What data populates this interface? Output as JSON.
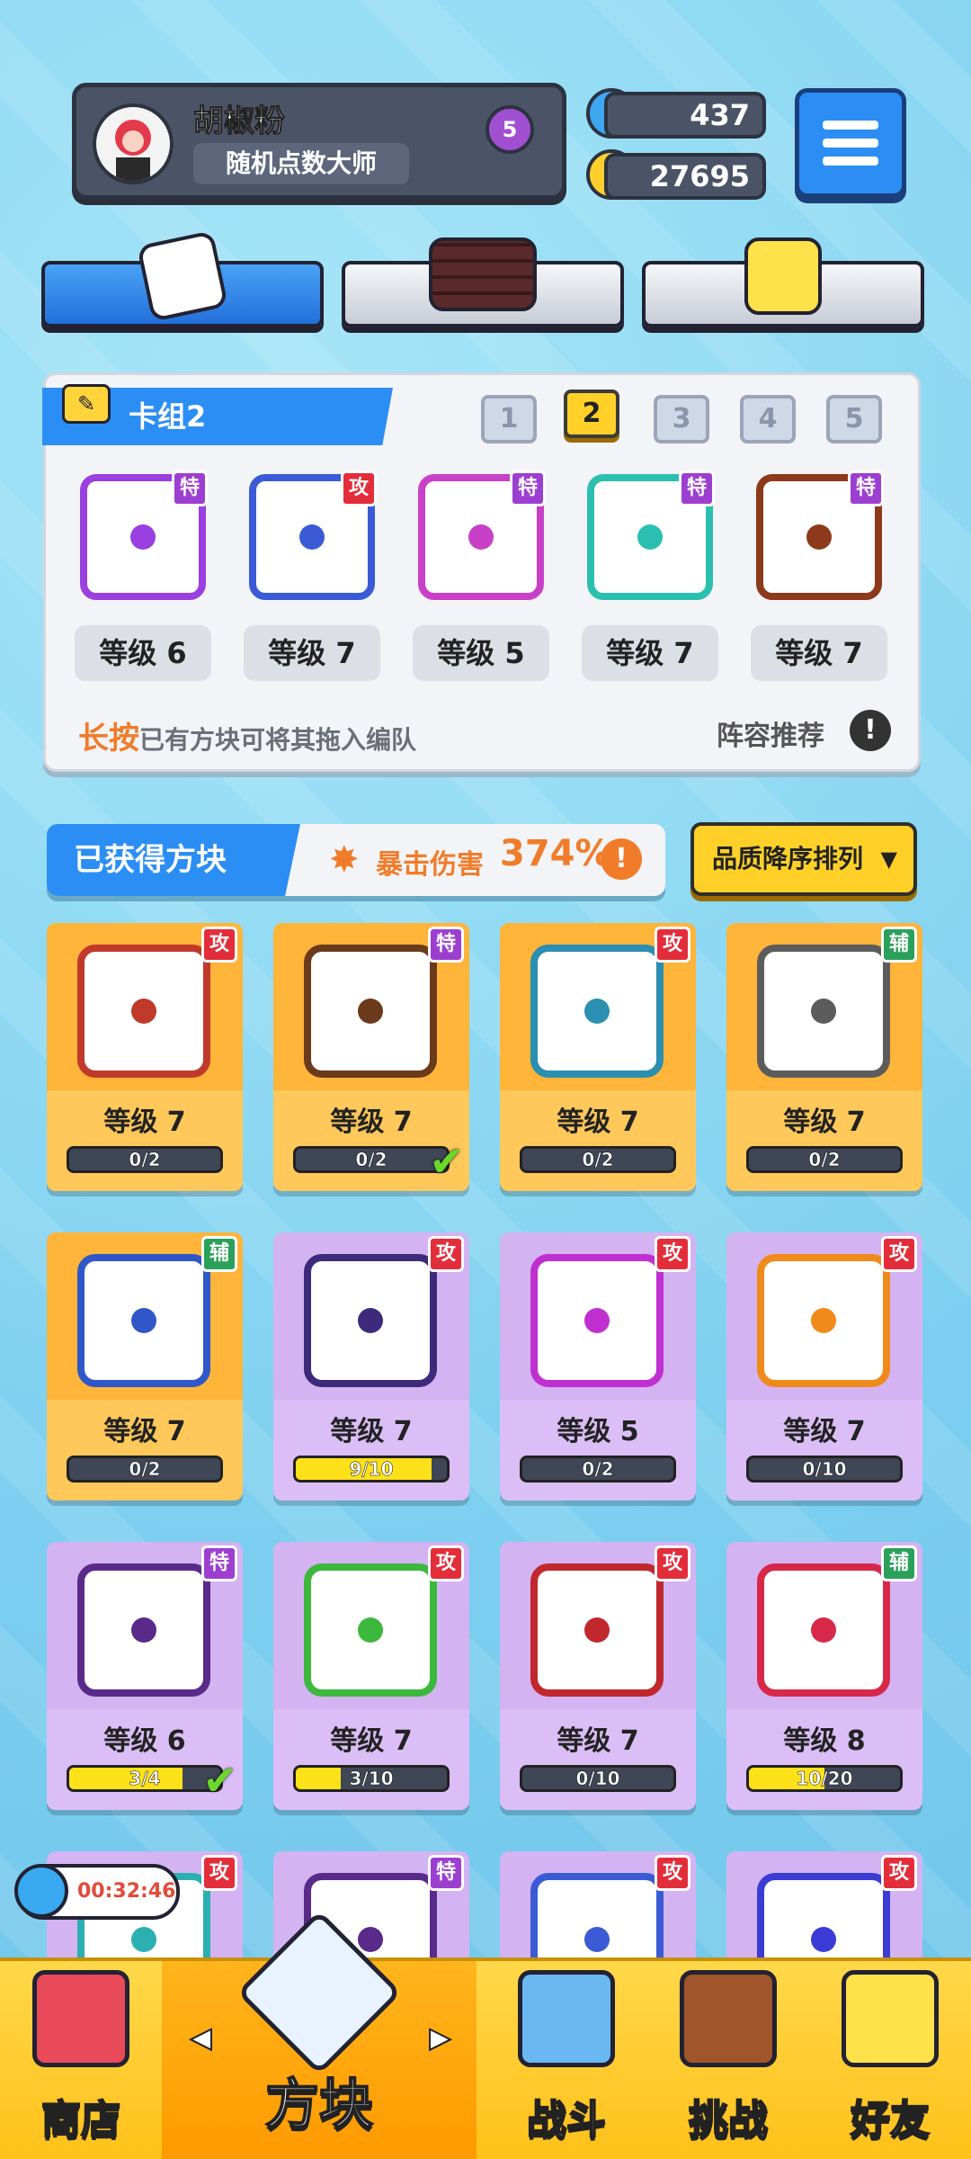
{
  "player": {
    "name": "胡椒粉",
    "title": "随机点数大师",
    "rank": "5"
  },
  "currency": {
    "gems": "437",
    "coins": "27695"
  },
  "deck": {
    "label": "卡组2",
    "numbers": [
      "1",
      "2",
      "3",
      "4",
      "5"
    ],
    "selected": "2",
    "dice": [
      {
        "tag": "特",
        "level": "等级 6",
        "color": "#9a3fe0"
      },
      {
        "tag": "攻",
        "level": "等级 7",
        "color": "#3b5bd6"
      },
      {
        "tag": "特",
        "level": "等级 5",
        "color": "#c840c8"
      },
      {
        "tag": "特",
        "level": "等级 7",
        "color": "#2bbfb0"
      },
      {
        "tag": "特",
        "level": "等级 7",
        "color": "#8c3a1a"
      }
    ],
    "hint_bold": "长按",
    "hint_rest": "已有方块可将其拖入编队",
    "lineup": "阵容推荐"
  },
  "owned": {
    "label": "已获得方块",
    "crit_label": "暴击伤害",
    "crit_value": "374%",
    "sort_label": "品质降序排列"
  },
  "cards": [
    {
      "tag": "攻",
      "level": "等级 7",
      "progress": "0/2",
      "fill": 0,
      "bg": "gold",
      "color": "#c0392b"
    },
    {
      "tag": "特",
      "level": "等级 7",
      "progress": "0/2",
      "fill": 0,
      "bg": "gold",
      "color": "#6b3a1a",
      "check": true
    },
    {
      "tag": "攻",
      "level": "等级 7",
      "progress": "0/2",
      "fill": 0,
      "bg": "gold",
      "color": "#2a8fb0"
    },
    {
      "tag": "辅",
      "level": "等级 7",
      "progress": "0/2",
      "fill": 0,
      "bg": "gold",
      "color": "#5c5c5c"
    },
    {
      "tag": "辅",
      "level": "等级 7",
      "progress": "0/2",
      "fill": 0,
      "bg": "gold",
      "color": "#2f57c8"
    },
    {
      "tag": "攻",
      "level": "等级 7",
      "progress": "9/10",
      "fill": 0.9,
      "bg": "purple",
      "color": "#3d2a7a"
    },
    {
      "tag": "攻",
      "level": "等级 5",
      "progress": "0/2",
      "fill": 0,
      "bg": "purple",
      "color": "#c02fd0"
    },
    {
      "tag": "攻",
      "level": "等级 7",
      "progress": "0/10",
      "fill": 0,
      "bg": "purple",
      "color": "#f08a1a"
    },
    {
      "tag": "特",
      "level": "等级 6",
      "progress": "3/4",
      "fill": 0.75,
      "bg": "purple",
      "color": "#5a2a8a",
      "check": true
    },
    {
      "tag": "攻",
      "level": "等级 7",
      "progress": "3/10",
      "fill": 0.3,
      "bg": "purple",
      "color": "#3cb83c"
    },
    {
      "tag": "攻",
      "level": "等级 7",
      "progress": "0/10",
      "fill": 0,
      "bg": "purple",
      "color": "#c0282e"
    },
    {
      "tag": "辅",
      "level": "等级 8",
      "progress": "10/20",
      "fill": 0.5,
      "bg": "purple",
      "color": "#d8284a"
    },
    {
      "tag": "攻",
      "bg": "purple",
      "color": "#2ab0b0"
    },
    {
      "tag": "特",
      "bg": "purple",
      "color": "#5a2a8a"
    },
    {
      "tag": "攻",
      "bg": "purple",
      "color": "#3b5bd6"
    },
    {
      "tag": "攻",
      "bg": "purple",
      "color": "#3b3bd6"
    }
  ],
  "timer": "00:32:46",
  "nav": [
    "商店",
    "方块",
    "战斗",
    "挑战",
    "好友"
  ],
  "nav_arrows": {
    "left": "◀",
    "right": "▶"
  }
}
